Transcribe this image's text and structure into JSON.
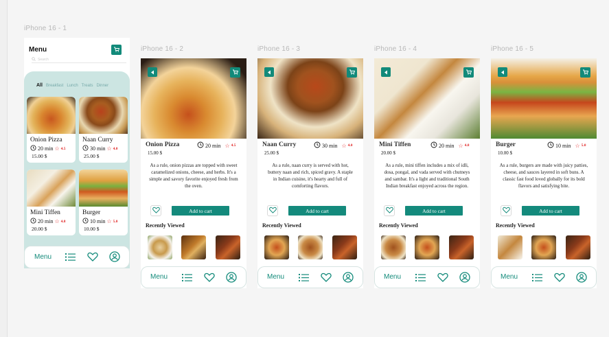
{
  "frames": [
    {
      "label": "iPhone 16 - 1"
    },
    {
      "label": "iPhone 16 - 2"
    },
    {
      "label": "iPhone 16 - 3"
    },
    {
      "label": "iPhone 16 - 4"
    },
    {
      "label": "iPhone 16 - 5"
    }
  ],
  "menu": {
    "title": "Menu",
    "search_placeholder": "Search",
    "categories": [
      "All",
      "Breakfast",
      "Lunch",
      "Treats",
      "Dinner"
    ],
    "cards": [
      {
        "name": "Onion Pizza",
        "time": "20 min",
        "rating": "4.5",
        "price": "15.00 $"
      },
      {
        "name": "Naan Curry",
        "time": "30 min",
        "rating": "4.0",
        "price": "25.00 $"
      },
      {
        "name": "Mini Tiffen",
        "time": "20 min",
        "rating": "4.8",
        "price": "20.00 $"
      },
      {
        "name": "Burger",
        "time": "10 min",
        "rating": "5.0",
        "price": "10.00 $"
      }
    ]
  },
  "nav": {
    "menu_label": "Menu"
  },
  "details": [
    {
      "name": "Onion Pizza",
      "time": "20 min",
      "rating": "4.5",
      "price": "15.00 $",
      "description": "As a rule, onion pizzas are topped with sweet caramelized onions, cheese, and herbs. It's a simple and savory favorite enjoyed fresh from the oven."
    },
    {
      "name": "Naan Curry",
      "time": "30 min",
      "rating": "4.0",
      "price": "25.00 $",
      "description": "As a rule, naan curry is served with hot, buttery naan and rich, spiced gravy. A staple in Indian cuisine, it's hearty and full of comforting flavors."
    },
    {
      "name": "Mini Tiffen",
      "time": "20 min",
      "rating": "4.8",
      "price": "20.00 $",
      "description": "As a rule, mini tiffen includes a mix of idli, dosa, pongal, and vada served with chutneys and sambar. It's a light and traditional South Indian breakfast enjoyed across the region."
    },
    {
      "name": "Burger",
      "time": "10 min",
      "rating": "5.0",
      "price": "10.00 $",
      "description": "As a rule, burgers are made with juicy patties, cheese, and sauces layered in soft buns. A classic fast food loved globally for its bold flavors and satisfying bite."
    }
  ],
  "detail_labels": {
    "add_to_cart": "Add to cart",
    "recently_viewed": "Recently Viewed"
  },
  "colors": {
    "accent": "#148a7c",
    "panel": "#cce5e2",
    "rating": "#e02020"
  }
}
